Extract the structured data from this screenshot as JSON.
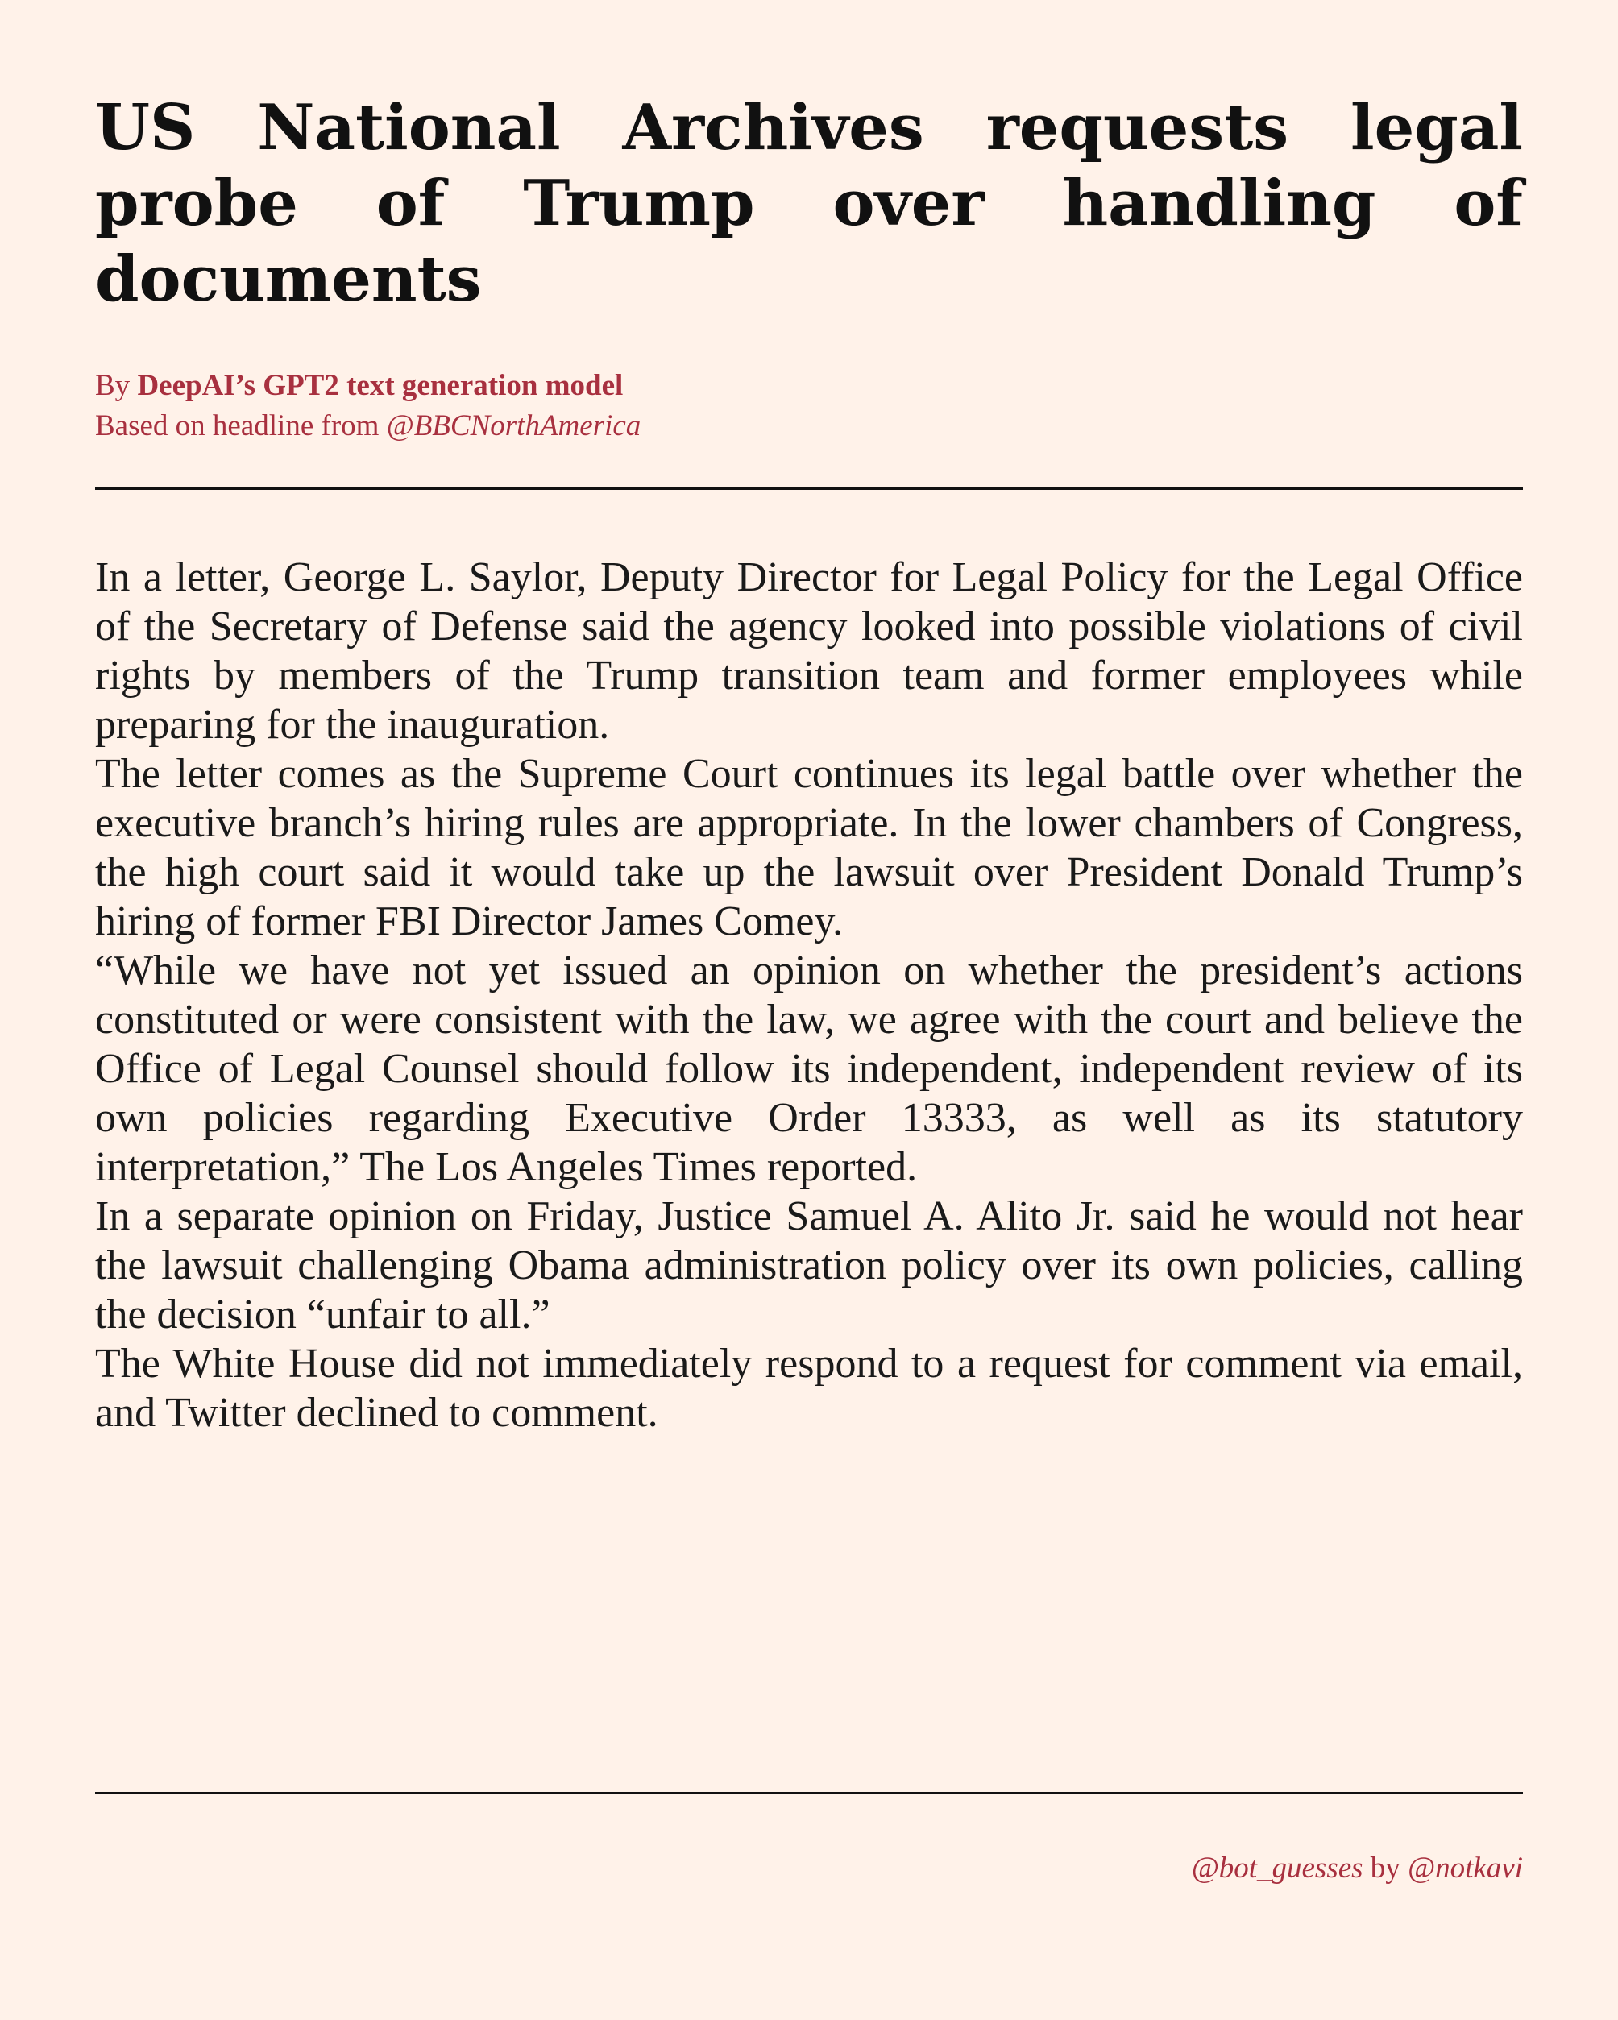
{
  "article": {
    "headline": "US National Archives requests legal probe of Trump over handling of documents",
    "byline": {
      "prefix": "By ",
      "author": "DeepAI’s GPT2 text generation model",
      "source_prefix": "Based on headline from ",
      "source_handle": "@BBCNorthAmerica"
    },
    "paragraphs": [
      "In a letter, George L. Saylor, Deputy Director for Legal Policy for the Legal Office of the Secretary of Defense said the agency looked into possible violations of civil rights by members of the Trump transition team and former employees while preparing for the inauguration.",
      "The letter comes as the Supreme Court continues its legal battle over whether the executive branch’s hiring rules are appropriate.  In the lower chambers of Congress, the high court said it would take up the lawsuit over President Donald Trump’s hiring of former FBI Director James Comey.",
      "“While we have not yet issued an opinion on whether the president’s actions constituted or were consistent with the law, we agree with the court and believe the Office of Legal Counsel should follow its independent, independent review of its own policies regarding Executive Order 13333, as well as its statutory interpretation,” The Los Angeles Times reported.",
      "In a separate opinion on Friday, Justice Samuel A. Alito Jr.  said he would not hear the lawsuit challenging Obama administration policy over its own policies, calling the decision “unfair to all.”",
      "The White House did not immediately respond to a request for comment via email, and Twitter declined to comment."
    ]
  },
  "footer": {
    "bot_handle": "@bot_guesses",
    "by_text": " by ",
    "author_handle": "@notkavi"
  },
  "colors": {
    "background": "#fff2e9",
    "accent": "#a8303f",
    "text": "#111111"
  }
}
